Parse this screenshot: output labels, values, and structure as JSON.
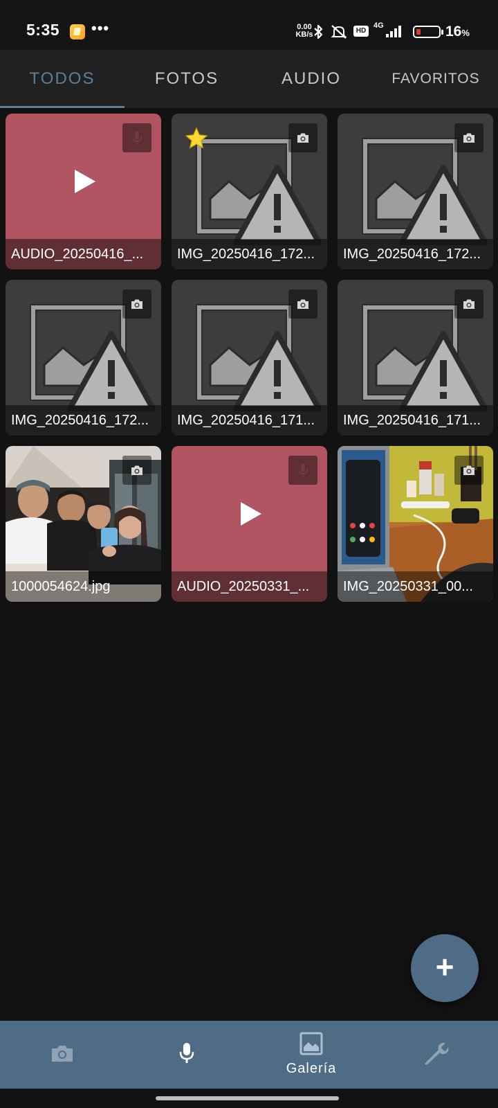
{
  "status_bar": {
    "time": "5:35",
    "dots": "•••",
    "net_speed_value": "0.00",
    "net_speed_unit": "KB/s",
    "hd_badge": "HD",
    "network_type": "4G",
    "battery_percent": "16",
    "battery_unit": "%",
    "icons": [
      "notification-app-icon",
      "bluetooth-icon",
      "mute-icon",
      "hd-icon",
      "signal-icon",
      "battery-icon"
    ]
  },
  "tabs": [
    {
      "label": "TODOS",
      "active": true
    },
    {
      "label": "FOTOS",
      "active": false
    },
    {
      "label": "AUDIO",
      "active": false
    },
    {
      "label": "FAVORITOS",
      "active": false
    }
  ],
  "grid": [
    {
      "caption": "AUDIO_20250416_...",
      "type": "audio",
      "favorite": false
    },
    {
      "caption": "IMG_20250416_172...",
      "type": "broken-image",
      "favorite": true
    },
    {
      "caption": "IMG_20250416_172...",
      "type": "broken-image",
      "favorite": false
    },
    {
      "caption": "IMG_20250416_172...",
      "type": "broken-image",
      "favorite": false
    },
    {
      "caption": "IMG_20250416_171...",
      "type": "broken-image",
      "favorite": false
    },
    {
      "caption": "IMG_20250416_171...",
      "type": "broken-image",
      "favorite": false
    },
    {
      "caption": "1000054624.jpg",
      "type": "photo",
      "favorite": false
    },
    {
      "caption": "AUDIO_20250331_...",
      "type": "audio",
      "favorite": false
    },
    {
      "caption": "IMG_20250331_00...",
      "type": "photo",
      "favorite": false
    }
  ],
  "fab": {
    "label": "+"
  },
  "bottom_nav": [
    {
      "icon": "camera-icon",
      "label": ""
    },
    {
      "icon": "microphone-icon",
      "label": ""
    },
    {
      "icon": "gallery-icon",
      "label": "Galería",
      "active": true
    },
    {
      "icon": "wrench-icon",
      "label": ""
    }
  ],
  "colors": {
    "accent": "#5d7e98",
    "nav_bar": "#4f6c86",
    "audio_tile": "#b05561",
    "favorite_star": "#fdd835"
  }
}
